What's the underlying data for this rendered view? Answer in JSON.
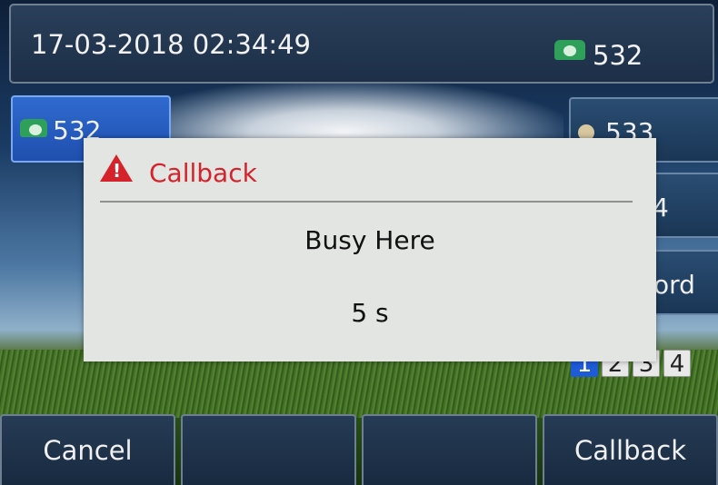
{
  "status_bar": {
    "datetime": "17-03-2018 02:34:49",
    "line_icon": "phone-icon",
    "line_number": "532"
  },
  "line_keys": {
    "left": {
      "label": "532",
      "icon": "phone-icon"
    },
    "right": [
      {
        "label": "533",
        "icon": "user-icon"
      },
      {
        "label": "4",
        "icon": ""
      },
      {
        "label": "tord",
        "icon": ""
      }
    ]
  },
  "page_indicator": {
    "pages": [
      "1",
      "2",
      "3",
      "4"
    ],
    "current": "1"
  },
  "dialog": {
    "icon": "warning-icon",
    "title": "Callback",
    "message": "Busy Here",
    "countdown": "5 s",
    "title_color": "#d4232b"
  },
  "softkeys": [
    "Cancel",
    "",
    "",
    "Callback"
  ],
  "colors": {
    "active_page": "#1e5bd6",
    "line_key_active": "#2f6ad0",
    "phone_icon": "#2fa05a"
  }
}
